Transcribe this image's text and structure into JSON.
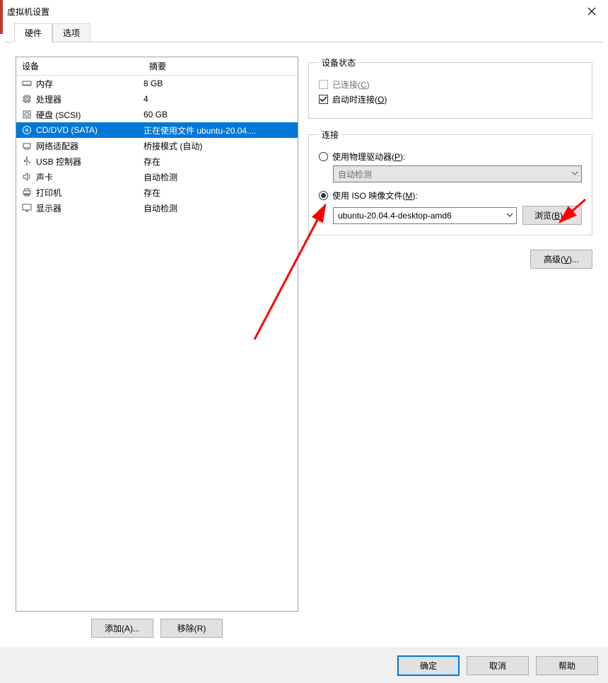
{
  "window": {
    "title": "虚拟机设置"
  },
  "tabs": {
    "hardware": "硬件",
    "options": "选项"
  },
  "deviceList": {
    "header": {
      "device": "设备",
      "summary": "摘要"
    },
    "items": [
      {
        "icon": "memory",
        "name": "内存",
        "summary": "8 GB"
      },
      {
        "icon": "cpu",
        "name": "处理器",
        "summary": "4"
      },
      {
        "icon": "disk",
        "name": "硬盘 (SCSI)",
        "summary": "60 GB"
      },
      {
        "icon": "cd",
        "name": "CD/DVD (SATA)",
        "summary": "正在使用文件 ubuntu-20.04...."
      },
      {
        "icon": "net",
        "name": "网络适配器",
        "summary": "桥接模式 (自动)"
      },
      {
        "icon": "usb",
        "name": "USB 控制器",
        "summary": "存在"
      },
      {
        "icon": "sound",
        "name": "声卡",
        "summary": "自动检测"
      },
      {
        "icon": "printer",
        "name": "打印机",
        "summary": "存在"
      },
      {
        "icon": "display",
        "name": "显示器",
        "summary": "自动检测"
      }
    ],
    "selectedIndex": 3,
    "buttons": {
      "add": "添加(A)...",
      "remove": "移除(R)"
    }
  },
  "deviceStatus": {
    "legend": "设备状态",
    "connected": {
      "label": "已连接(C)",
      "checked": false,
      "disabled": true
    },
    "connectAtPowerOn": {
      "label": "启动时连接(O)",
      "checked": true,
      "disabled": false
    }
  },
  "connection": {
    "legend": "连接",
    "usePhysical": {
      "label": "使用物理驱动器(P):",
      "selected": false
    },
    "physicalCombo": {
      "value": "自动检测",
      "disabled": true
    },
    "useIso": {
      "label": "使用 ISO 映像文件(M):",
      "selected": true
    },
    "isoCombo": {
      "value": "ubuntu-20.04.4-desktop-amd6"
    },
    "browse": "浏览(B)..."
  },
  "advanced": "高级(V)...",
  "footer": {
    "ok": "确定",
    "cancel": "取消",
    "help": "帮助"
  }
}
